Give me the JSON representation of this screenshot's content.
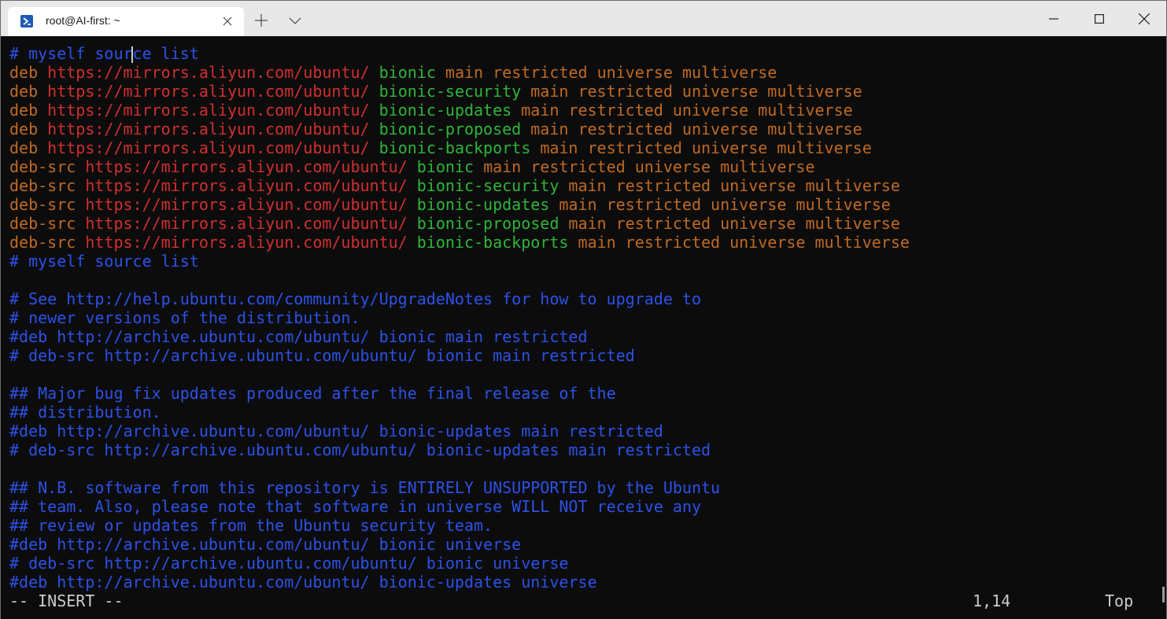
{
  "window": {
    "tab_title": "root@AI-first: ~",
    "tab_icon": "powershell-icon"
  },
  "colors": {
    "comment": "#2c52e6",
    "keyword": "#c06a24",
    "url": "#d12f2f",
    "suite": "#2fb53a",
    "text": "#cccccc",
    "background": "#0c0c0c"
  },
  "editor": {
    "lines": [
      [
        {
          "t": "# myself source list",
          "c": "blue"
        }
      ],
      [
        {
          "t": "deb ",
          "c": "orange"
        },
        {
          "t": "https://mirrors.aliyun.com/ubuntu/ ",
          "c": "red"
        },
        {
          "t": "bionic ",
          "c": "green"
        },
        {
          "t": "main restricted universe multiverse",
          "c": "orange"
        }
      ],
      [
        {
          "t": "deb ",
          "c": "orange"
        },
        {
          "t": "https://mirrors.aliyun.com/ubuntu/ ",
          "c": "red"
        },
        {
          "t": "bionic-security ",
          "c": "green"
        },
        {
          "t": "main restricted universe multiverse",
          "c": "orange"
        }
      ],
      [
        {
          "t": "deb ",
          "c": "orange"
        },
        {
          "t": "https://mirrors.aliyun.com/ubuntu/ ",
          "c": "red"
        },
        {
          "t": "bionic-updates ",
          "c": "green"
        },
        {
          "t": "main restricted universe multiverse",
          "c": "orange"
        }
      ],
      [
        {
          "t": "deb ",
          "c": "orange"
        },
        {
          "t": "https://mirrors.aliyun.com/ubuntu/ ",
          "c": "red"
        },
        {
          "t": "bionic-proposed ",
          "c": "green"
        },
        {
          "t": "main restricted universe multiverse",
          "c": "orange"
        }
      ],
      [
        {
          "t": "deb ",
          "c": "orange"
        },
        {
          "t": "https://mirrors.aliyun.com/ubuntu/ ",
          "c": "red"
        },
        {
          "t": "bionic-backports ",
          "c": "green"
        },
        {
          "t": "main restricted universe multiverse",
          "c": "orange"
        }
      ],
      [
        {
          "t": "deb-src ",
          "c": "orange"
        },
        {
          "t": "https://mirrors.aliyun.com/ubuntu/ ",
          "c": "red"
        },
        {
          "t": "bionic ",
          "c": "green"
        },
        {
          "t": "main restricted universe multiverse",
          "c": "orange"
        }
      ],
      [
        {
          "t": "deb-src ",
          "c": "orange"
        },
        {
          "t": "https://mirrors.aliyun.com/ubuntu/ ",
          "c": "red"
        },
        {
          "t": "bionic-security ",
          "c": "green"
        },
        {
          "t": "main restricted universe multiverse",
          "c": "orange"
        }
      ],
      [
        {
          "t": "deb-src ",
          "c": "orange"
        },
        {
          "t": "https://mirrors.aliyun.com/ubuntu/ ",
          "c": "red"
        },
        {
          "t": "bionic-updates ",
          "c": "green"
        },
        {
          "t": "main restricted universe multiverse",
          "c": "orange"
        }
      ],
      [
        {
          "t": "deb-src ",
          "c": "orange"
        },
        {
          "t": "https://mirrors.aliyun.com/ubuntu/ ",
          "c": "red"
        },
        {
          "t": "bionic-proposed ",
          "c": "green"
        },
        {
          "t": "main restricted universe multiverse",
          "c": "orange"
        }
      ],
      [
        {
          "t": "deb-src ",
          "c": "orange"
        },
        {
          "t": "https://mirrors.aliyun.com/ubuntu/ ",
          "c": "red"
        },
        {
          "t": "bionic-backports ",
          "c": "green"
        },
        {
          "t": "main restricted universe multiverse",
          "c": "orange"
        }
      ],
      [
        {
          "t": "# myself source list",
          "c": "blue"
        }
      ],
      [],
      [
        {
          "t": "# See http://help.ubuntu.com/community/UpgradeNotes for how to upgrade to",
          "c": "blue"
        }
      ],
      [
        {
          "t": "# newer versions of the distribution.",
          "c": "blue"
        }
      ],
      [
        {
          "t": "#deb http://archive.ubuntu.com/ubuntu/ bionic main restricted",
          "c": "blue"
        }
      ],
      [
        {
          "t": "# deb-src http://archive.ubuntu.com/ubuntu/ bionic main restricted",
          "c": "blue"
        }
      ],
      [],
      [
        {
          "t": "## Major bug fix updates produced after the final release of the",
          "c": "blue"
        }
      ],
      [
        {
          "t": "## distribution.",
          "c": "blue"
        }
      ],
      [
        {
          "t": "#deb http://archive.ubuntu.com/ubuntu/ bionic-updates main restricted",
          "c": "blue"
        }
      ],
      [
        {
          "t": "# deb-src http://archive.ubuntu.com/ubuntu/ bionic-updates main restricted",
          "c": "blue"
        }
      ],
      [],
      [
        {
          "t": "## N.B. software from this repository is ENTIRELY UNSUPPORTED by the Ubuntu",
          "c": "blue"
        }
      ],
      [
        {
          "t": "## team. Also, please note that software in universe WILL NOT receive any",
          "c": "blue"
        }
      ],
      [
        {
          "t": "## review or updates from the Ubuntu security team.",
          "c": "blue"
        }
      ],
      [
        {
          "t": "#deb http://archive.ubuntu.com/ubuntu/ bionic universe",
          "c": "blue"
        }
      ],
      [
        {
          "t": "# deb-src http://archive.ubuntu.com/ubuntu/ bionic universe",
          "c": "blue"
        }
      ],
      [
        {
          "t": "#deb http://archive.ubuntu.com/ubuntu/ bionic-updates universe",
          "c": "blue"
        }
      ]
    ]
  },
  "status": {
    "mode": "-- INSERT --",
    "position": "1,14",
    "scroll": "Top"
  }
}
